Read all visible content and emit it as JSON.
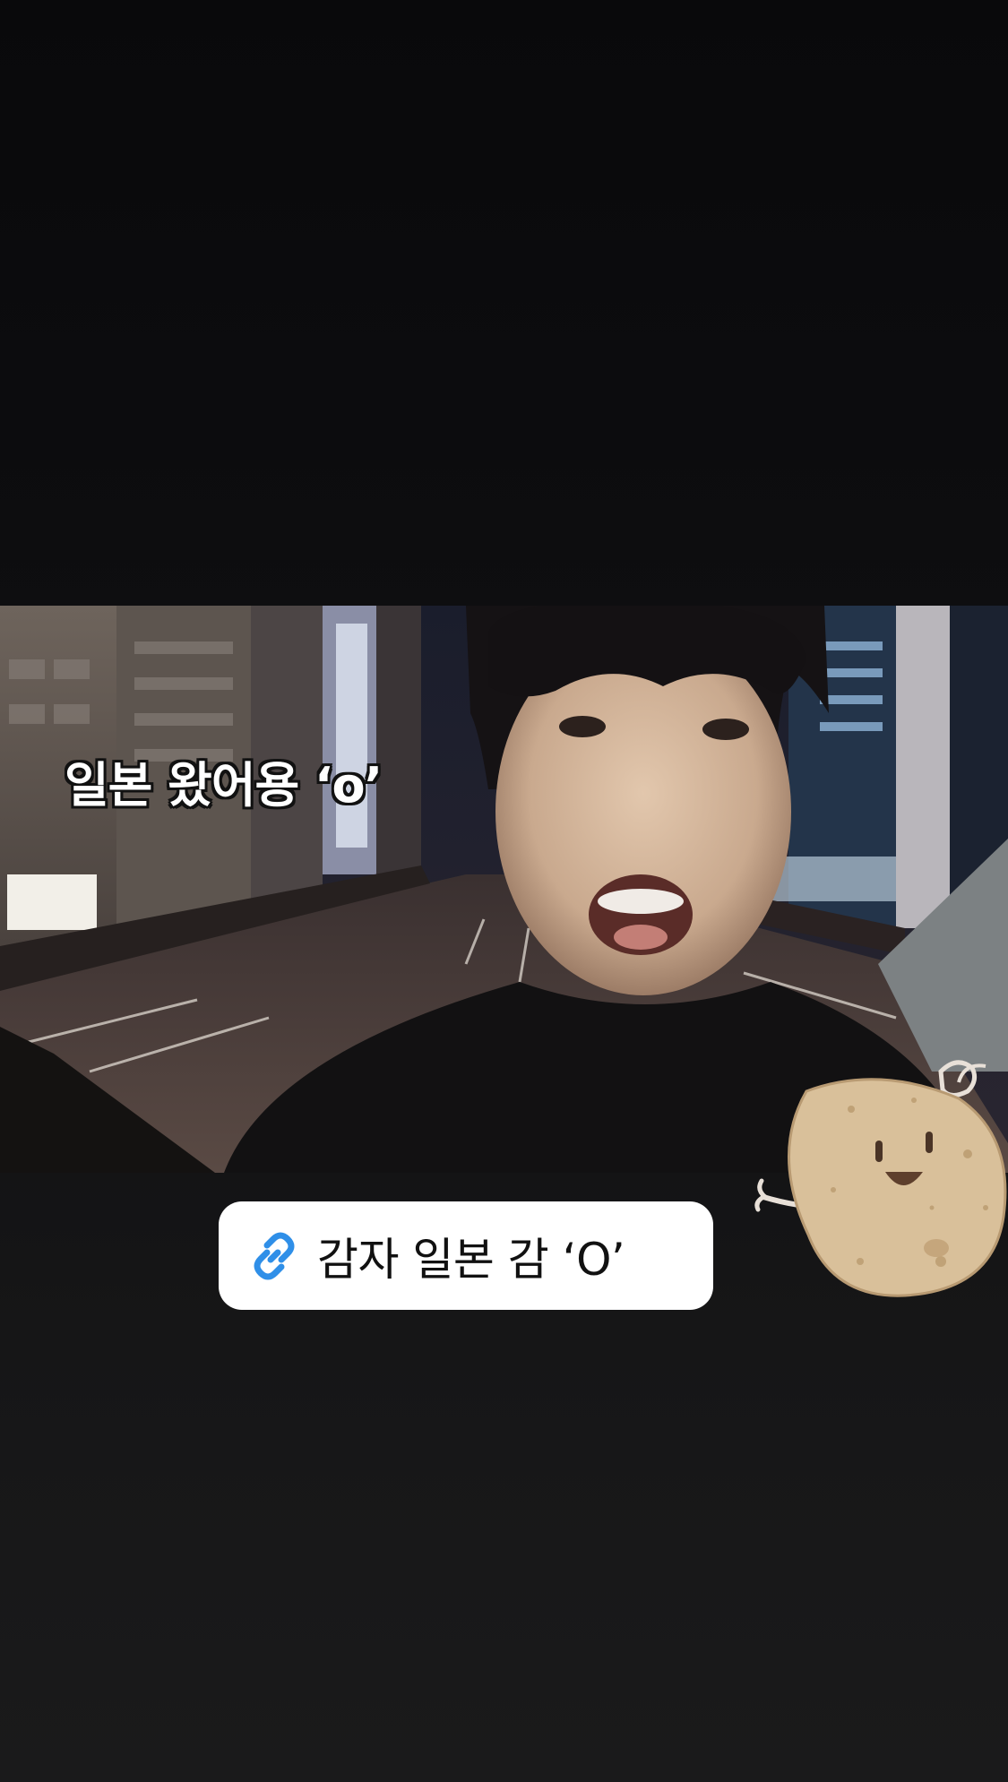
{
  "story": {
    "video": {
      "caption": "일본 왔어용 ‘o’"
    },
    "link_sticker": {
      "label": "감자 일본 감 ‘O’",
      "icon": "link-icon",
      "icon_color": "#2f8fe8"
    },
    "decoration": {
      "sticker": "potato-character-sticker"
    }
  },
  "colors": {
    "background": "#0e0e10",
    "sticker_bg": "#ffffff",
    "link_blue": "#2f8fe8"
  }
}
